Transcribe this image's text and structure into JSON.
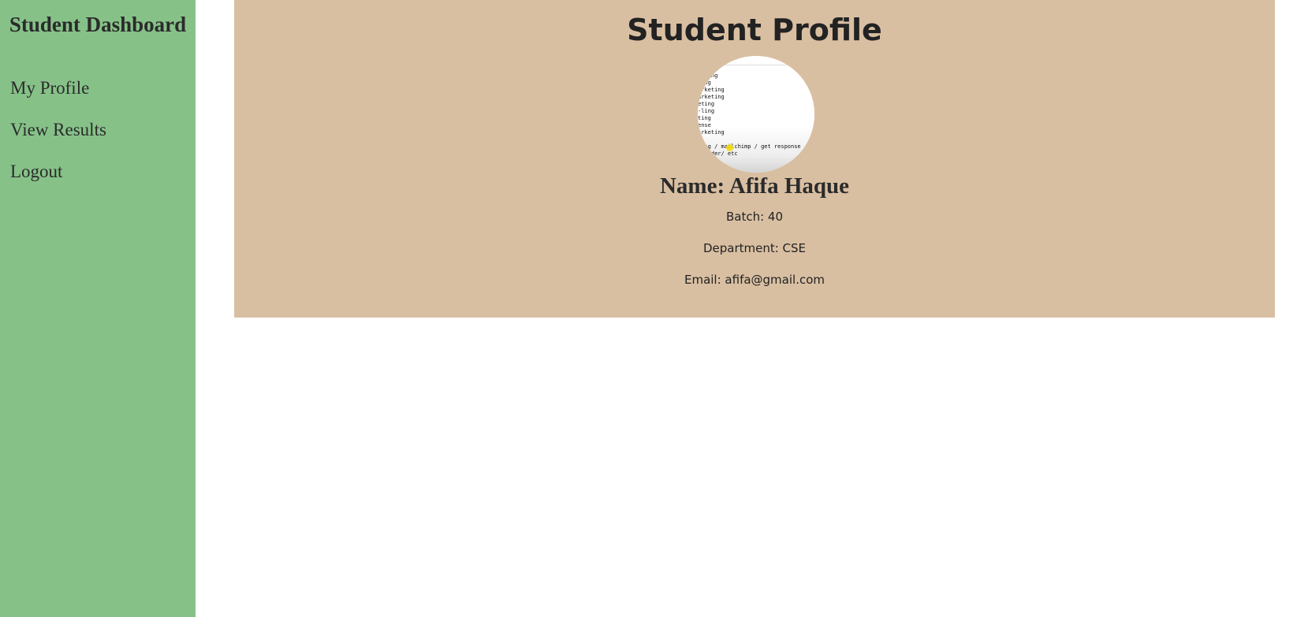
{
  "sidebar": {
    "title": "Student Dashboard",
    "items": [
      {
        "label": "My Profile"
      },
      {
        "label": "View Results"
      },
      {
        "label": "Logout"
      }
    ]
  },
  "profile": {
    "title": "Student Profile",
    "avatar_text": "ing\nketing\nting\narketing\narketing\neting\n-ling\nting\nense\narketing\n\nting / mailchimp / get response\n sender/ etc",
    "name_text": "Name: Afifa Haque",
    "batch_text": "Batch: 40",
    "department_text": "Department: CSE",
    "email_text": "Email: afifa@gmail.com"
  },
  "colors": {
    "sidebar_bg": "#86c288",
    "card_bg": "#d9bfa2",
    "text": "#222222"
  }
}
